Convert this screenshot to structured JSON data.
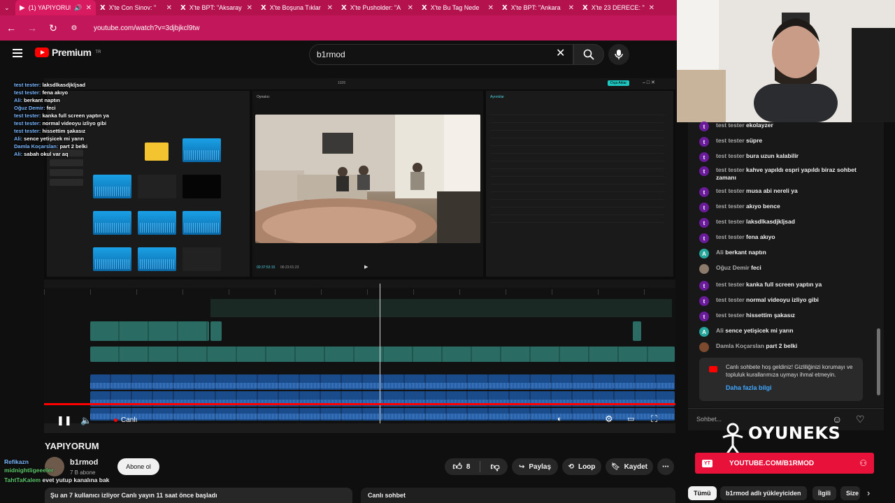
{
  "browser": {
    "tabs": [
      {
        "label": "(1) YAPIYORUM",
        "active": true
      },
      {
        "label": "X'te Con Sinov: \"",
        "active": false
      },
      {
        "label": "X'te BPT: \"Aksaray",
        "active": false
      },
      {
        "label": "X'te Boşuna Tıklar",
        "active": false
      },
      {
        "label": "X'te Pusholder: \"A",
        "active": false
      },
      {
        "label": "X'te Bu Tag Nede",
        "active": false
      },
      {
        "label": "X'te BPT: \"Ankara",
        "active": false
      },
      {
        "label": "X'te 23 DERECE: \"",
        "active": false
      }
    ],
    "url": "youtube.com/watch?v=3djbjkcl9tw",
    "accent": "#c2185b"
  },
  "header": {
    "logo": "Premium",
    "region": "TR",
    "search_value": "b1rmod"
  },
  "capcut": {
    "window_title": "1026",
    "overlay_chat": [
      {
        "user": "test tester:",
        "text": "laksdlkasdjkljsad"
      },
      {
        "user": "test tester:",
        "text": "fena akıyo"
      },
      {
        "user": "Ali:",
        "text": "berkant naptın"
      },
      {
        "user": "Oğuz Demir:",
        "text": "feci"
      },
      {
        "user": "test tester:",
        "text": "kanka full screen yaptın ya"
      },
      {
        "user": "test tester:",
        "text": "normal videoyu izliyo gibi"
      },
      {
        "user": "test tester:",
        "text": "hissettim şakasız"
      },
      {
        "user": "Ali:",
        "text": "sence yetişicek mi yarın"
      },
      {
        "user": "Damla Koçarslan:",
        "text": "part 2 belki"
      },
      {
        "user": "Ali:",
        "text": "sabah okul var aq"
      }
    ],
    "player_label": "Oynatıcı",
    "details_label": "Ayrıntılar",
    "export_label": "Dışa Aktar",
    "time_current": "00:37:53:15",
    "time_total": "06:23:01:23",
    "live_progress": 1.0
  },
  "player": {
    "live_label": "Canlı"
  },
  "video": {
    "title": "YAPIYORUM",
    "channel": "b1rmod",
    "subscribers": "7 B abone",
    "subscribe_label": "Abone ol",
    "likes": "8",
    "share_label": "Paylaş",
    "loop_label": "Loop",
    "save_label": "Kaydet",
    "description": "Şu an 7 kullanıcı izliyor  Canlı yayın 11 saat önce başladı",
    "livechat_label": "Canlı sohbet"
  },
  "obs_chat": [
    {
      "user": "Refikazn",
      "text": ""
    },
    {
      "user": "midnightligeeeler",
      "text": ""
    },
    {
      "user": "TahtTaKalem",
      "text": "evet yutup kanalına bak"
    }
  ],
  "chat": {
    "messages": [
      {
        "author": "test tester",
        "text": "ekolayzer",
        "avatar": "t",
        "color": "#6a1b9a"
      },
      {
        "author": "test tester",
        "text": "süpre",
        "avatar": "t",
        "color": "#6a1b9a"
      },
      {
        "author": "test tester",
        "text": "bura uzun kalabilir",
        "avatar": "t",
        "color": "#6a1b9a"
      },
      {
        "author": "test tester",
        "text": "kahve yapıldı espri yapıldı biraz sohbet zamanı",
        "avatar": "t",
        "color": "#6a1b9a"
      },
      {
        "author": "test tester",
        "text": "musa abi nereli ya",
        "avatar": "t",
        "color": "#6a1b9a"
      },
      {
        "author": "test tester",
        "text": "akıyo bence",
        "avatar": "t",
        "color": "#6a1b9a"
      },
      {
        "author": "test tester",
        "text": "laksdlkasdjkljsad",
        "avatar": "t",
        "color": "#6a1b9a"
      },
      {
        "author": "test tester",
        "text": "fena akıyo",
        "avatar": "t",
        "color": "#6a1b9a"
      },
      {
        "author": "Ali",
        "text": "berkant naptın",
        "avatar": "A",
        "color": "#26a69a"
      },
      {
        "author": "Oğuz Demir",
        "text": "feci",
        "avatar": "",
        "color": "#8d7b6b"
      },
      {
        "author": "test tester",
        "text": "kanka full screen yaptın ya",
        "avatar": "t",
        "color": "#6a1b9a"
      },
      {
        "author": "test tester",
        "text": "normal videoyu izliyo gibi",
        "avatar": "t",
        "color": "#6a1b9a"
      },
      {
        "author": "test tester",
        "text": "hissettim şakasız",
        "avatar": "t",
        "color": "#6a1b9a"
      },
      {
        "author": "Ali",
        "text": "sence yetişicek mi yarın",
        "avatar": "A",
        "color": "#26a69a"
      },
      {
        "author": "Damla Koçarslan",
        "text": "part 2 belki",
        "avatar": "",
        "color": "#7b4a2f"
      }
    ],
    "welcome_text": "Canlı sohbete hoş geldiniz! Gizliliğinizi korumayı ve topluluk kurallarımıza uymayı ihmal etmeyin.",
    "learn_more": "Daha fazla bilgi",
    "input_placeholder": "Sohbet..."
  },
  "overlay": {
    "brand": "OYUNEKS",
    "banner_text": "YOUTUBE.COM/B1RMOD"
  },
  "chips": [
    "Tümü",
    "b1rmod adlı yükleyiciden",
    "İlgili",
    "Size"
  ]
}
